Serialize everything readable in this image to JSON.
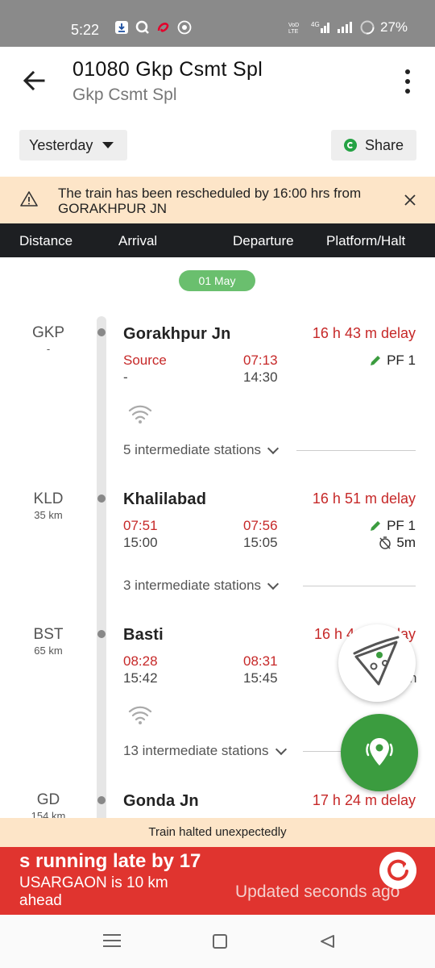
{
  "status_bar": {
    "time": "5:22",
    "network": "4G",
    "volte": "VoLTE",
    "battery": "27%",
    "app_icons": [
      "download-icon",
      "search-icon",
      "airtel-icon",
      "whatsapp-icon"
    ]
  },
  "header": {
    "title": "01080 Gkp Csmt Spl",
    "subtitle": "Gkp Csmt Spl",
    "day_selector": "Yesterday",
    "share_label": "Share"
  },
  "alert": {
    "text": "The train has been rescheduled by 16:00 hrs from GORAKHPUR JN"
  },
  "columns": [
    "Distance",
    "Arrival",
    "Departure",
    "Platform/Halt"
  ],
  "date_pill": "01 May",
  "stations": [
    {
      "code": "GKP",
      "km": "-",
      "name": "Gorakhpur Jn",
      "delay": "16 h 43 m delay",
      "arr_actual": "Source",
      "arr_sched": "-",
      "dep_actual": "07:13",
      "dep_sched": "14:30",
      "platform": "PF 1",
      "halt": "",
      "intermediate": "5 intermediate stations"
    },
    {
      "code": "KLD",
      "km": "35 km",
      "name": "Khalilabad",
      "delay": "16 h 51 m delay",
      "arr_actual": "07:51",
      "arr_sched": "15:00",
      "dep_actual": "07:56",
      "dep_sched": "15:05",
      "platform": "PF 1",
      "halt": "5m",
      "intermediate": "3 intermediate stations"
    },
    {
      "code": "BST",
      "km": "65 km",
      "name": "Basti",
      "delay": "16 h 4",
      "delay_tail": "lay",
      "arr_actual": "08:28",
      "arr_sched": "15:42",
      "dep_actual": "08:31",
      "dep_sched": "15:45",
      "platform": "",
      "halt_tail": "n",
      "intermediate": "13 intermediate stations"
    },
    {
      "code": "GD",
      "km": "154 km",
      "name": "Gonda Jn",
      "delay": "17 h 24 m delay"
    }
  ],
  "bottom": {
    "halt_notice": "Train halted unexpectedly",
    "running_text": "s running late by 17",
    "ahead_text": "USARGAON is 10 km ahead",
    "updated": "Updated seconds  ago"
  },
  "colors": {
    "delay_red": "#c62828",
    "accent_green": "#3b9c3f",
    "banner": "#fde5c8",
    "running_bar": "#e0342f"
  }
}
